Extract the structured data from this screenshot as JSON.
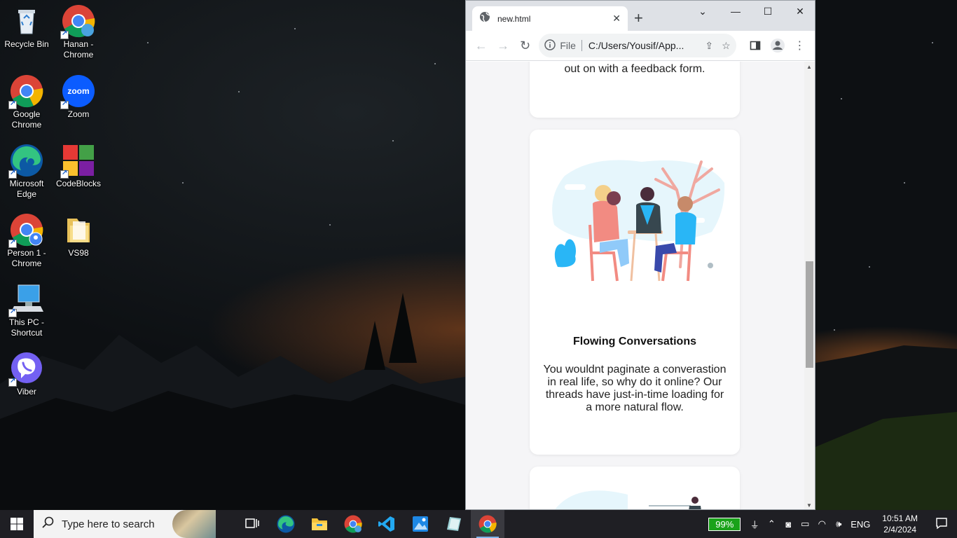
{
  "desktop": {
    "icons": [
      {
        "label": "Recycle Bin",
        "icon": "recycle-bin-icon"
      },
      {
        "label": "Hanan - Chrome",
        "icon": "chrome-profile-icon"
      },
      {
        "label": "Google Chrome",
        "icon": "chrome-icon"
      },
      {
        "label": "Zoom",
        "icon": "zoom-icon"
      },
      {
        "label": "Microsoft Edge",
        "icon": "edge-icon"
      },
      {
        "label": "CodeBlocks",
        "icon": "codeblocks-icon"
      },
      {
        "label": "Person 1 - Chrome",
        "icon": "chrome-profile-icon"
      },
      {
        "label": "VS98",
        "icon": "folder-icon"
      },
      {
        "label": "This PC - Shortcut",
        "icon": "this-pc-icon"
      },
      {
        "label": "Viber",
        "icon": "viber-icon"
      }
    ]
  },
  "browser": {
    "tab_title": "new.html",
    "tab_close": "✕",
    "new_tab": "+",
    "address_scheme": "File",
    "address_url": "C:/Users/Yousif/App...",
    "window_controls": {
      "dropdown": "⌄",
      "minimize": "—",
      "maximize": "☐",
      "close": "✕"
    }
  },
  "page": {
    "card_top_text": "out on with a feedback form.",
    "card_main": {
      "title": "Flowing Conversations",
      "text": "You wouldnt paginate a converastion in real life, so why do it online? Our threads have just-in-time loading for a more natural flow."
    }
  },
  "taskbar": {
    "search_placeholder": "Type here to search",
    "battery": "99%",
    "language": "ENG",
    "time": "10:51 AM",
    "date": "2/4/2024"
  },
  "colors": {
    "chrome_tabstrip": "#dee1e6",
    "page_bg": "#f5f5f7",
    "battery_green": "#1aa21a",
    "taskbar_bg": "#1f1f24",
    "illustration_blue": "#29b6f6",
    "illustration_pink": "#f28b82"
  }
}
